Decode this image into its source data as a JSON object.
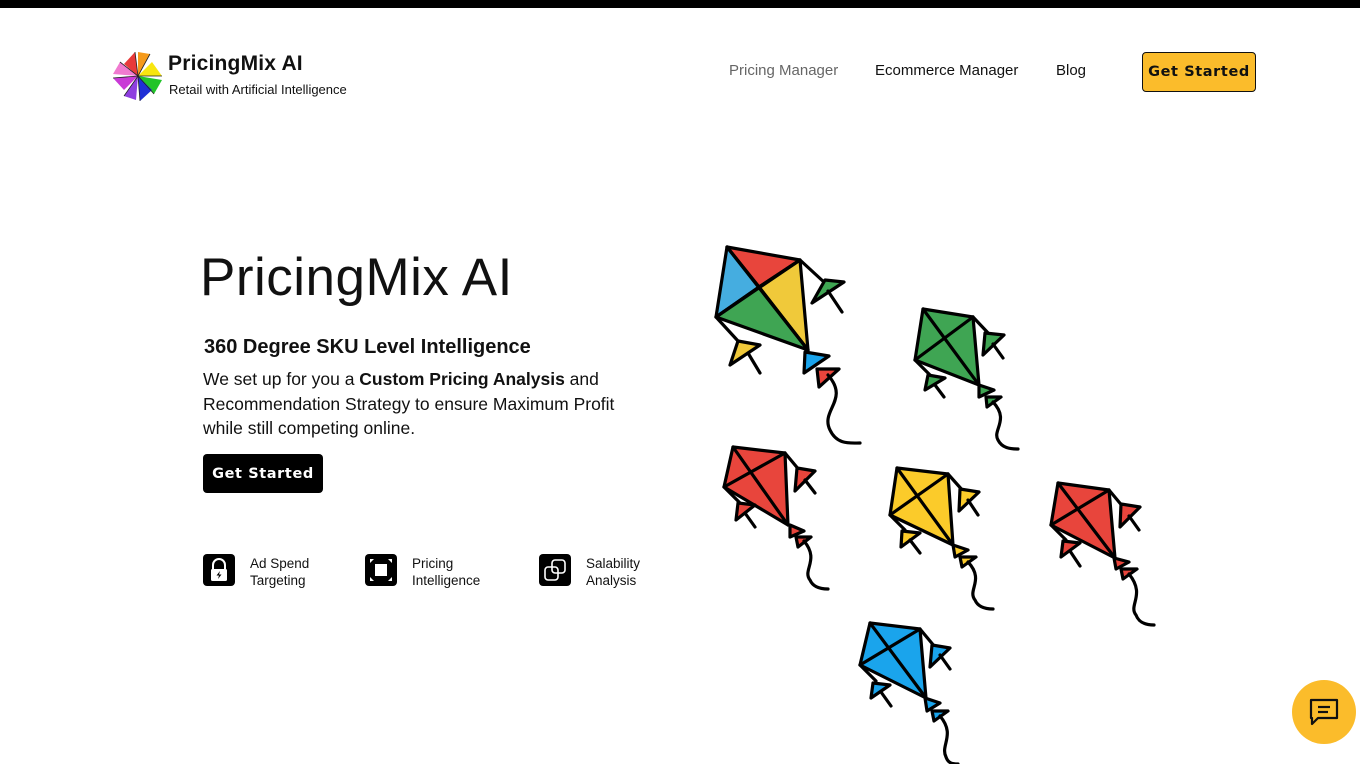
{
  "header": {
    "brand_title": "PricingMix AI",
    "brand_subtitle": "Retail with Artificial Intelligence",
    "logo_icon": "pinwheel-logo-icon",
    "nav_items": [
      {
        "label": "Pricing Manager",
        "active": true
      },
      {
        "label": "Ecommerce Manager",
        "active": false
      },
      {
        "label": "Blog",
        "active": false
      }
    ],
    "cta_label": "Get Started"
  },
  "hero": {
    "title": "PricingMix AI",
    "subtitle": "360 Degree SKU Level Intelligence",
    "desc_part1": "We set up for you a ",
    "desc_bold": "Custom Pricing Analysis",
    "desc_part2": " and Recommendation Strategy to ensure Maximum Profit while still competing online.",
    "cta_label": "Get Started",
    "illustration": "colorful-kites-illustration"
  },
  "features": [
    {
      "line1": "Ad Spend",
      "line2": "Targeting",
      "icon": "lock-bolt-icon"
    },
    {
      "line1": "Pricing",
      "line2": "Intelligence",
      "icon": "frame-square-icon"
    },
    {
      "line1": "Salability",
      "line2": "Analysis",
      "icon": "linked-squares-icon"
    }
  ],
  "chat": {
    "icon": "chat-message-icon"
  },
  "colors": {
    "accent_yellow": "#fbbc2b",
    "kite_red": "#e8453c",
    "kite_yellow": "#f5c52e",
    "kite_green": "#3fa553",
    "kite_blue": "#1aa4ec",
    "kite_lightblue": "#45ade0"
  }
}
